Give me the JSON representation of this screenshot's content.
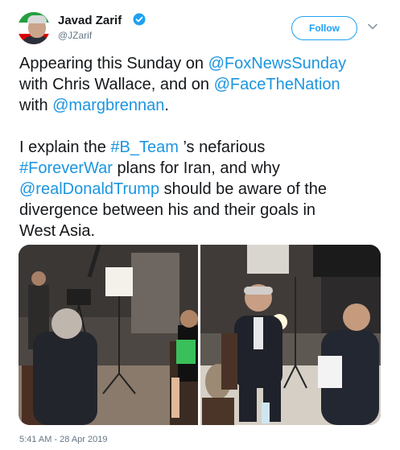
{
  "author": {
    "name": "Javad Zarif",
    "handle": "@JZarif",
    "verified": true,
    "avatar_icon": "avatar-photo"
  },
  "follow_button": {
    "label": "Follow",
    "color": "#1da1f2"
  },
  "menu": {
    "icon": "chevron-down-icon"
  },
  "tweet": {
    "line1_a": "Appearing this Sunday on ",
    "line1_link": "@FoxNewsSunday",
    "line2_a": "with Chris Wallace, and on ",
    "line2_link": "@FaceTheNation",
    "line3_a": "with ",
    "line3_link": "@margbrennan",
    "line3_b": ".",
    "line4_a": "I explain the ",
    "line4_link": "#B_Team",
    "line4_b": " ’s nefarious",
    "line5_link": "#ForeverWar",
    "line5_b": " plans for Iran, and why",
    "line6_link": "@realDonaldTrump",
    "line6_b": " should be aware of the",
    "line7": "divergence between his and their goals in",
    "line8": "West Asia."
  },
  "media": {
    "photos": [
      {
        "icon": "interview-photo-left"
      },
      {
        "icon": "interview-photo-right"
      }
    ]
  },
  "timestamp": "5:41 AM - 28 Apr 2019",
  "colors": {
    "link": "#1b95e0",
    "text": "#14171a",
    "muted": "#657786"
  }
}
